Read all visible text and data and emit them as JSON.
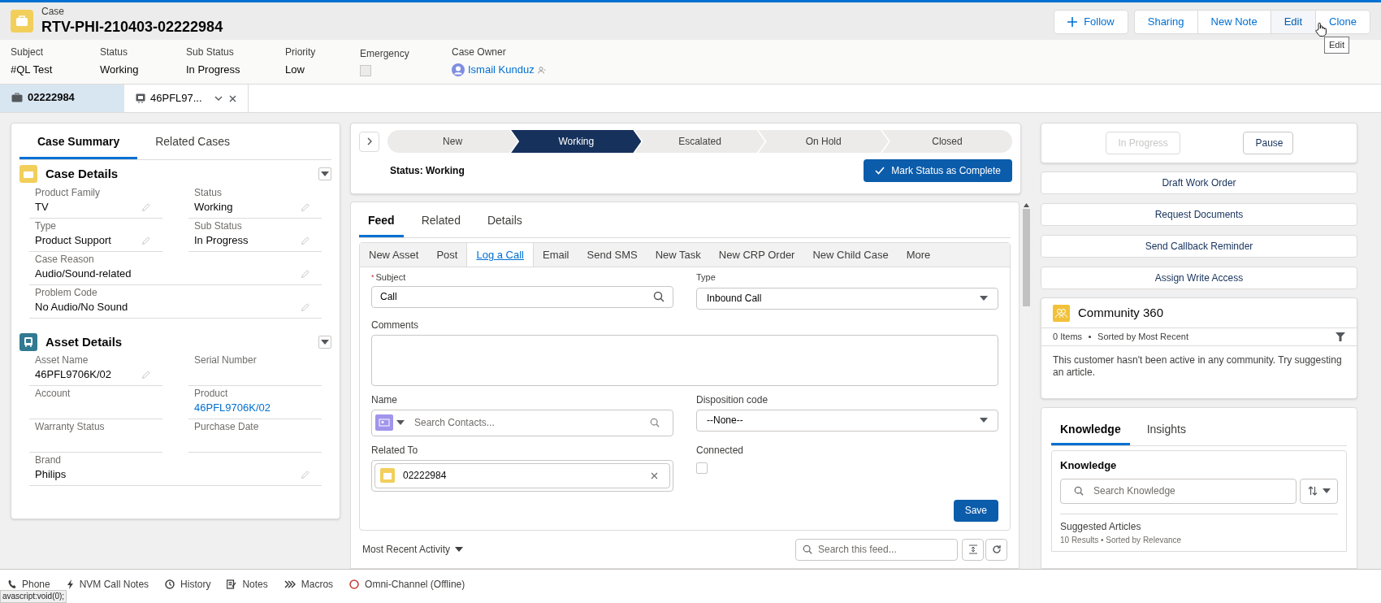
{
  "header": {
    "object_type": "Case",
    "title": "RTV-PHI-210403-02222984",
    "actions": [
      {
        "label": "Follow",
        "kind": "follow"
      },
      {
        "label": "Sharing",
        "kind": "plain"
      },
      {
        "label": "New Note",
        "kind": "plain"
      },
      {
        "label": "Edit",
        "kind": "hovered"
      },
      {
        "label": "Clone",
        "kind": "plain"
      }
    ],
    "tooltip": "Edit"
  },
  "highlights": [
    {
      "label": "Subject",
      "value": "#QL Test",
      "kind": "text"
    },
    {
      "label": "Status",
      "value": "Working",
      "kind": "text"
    },
    {
      "label": "Sub Status",
      "value": "In Progress",
      "kind": "text"
    },
    {
      "label": "Priority",
      "value": "Low",
      "kind": "text"
    },
    {
      "label": "Emergency",
      "kind": "checkbox",
      "checked": false
    },
    {
      "label": "Case Owner",
      "value": "Ismail Kunduz",
      "kind": "user"
    }
  ],
  "workspace_tabs": [
    {
      "label": "02222984",
      "selected": true,
      "kind": "case"
    },
    {
      "label": "46PFL97...",
      "selected": false,
      "kind": "asset"
    }
  ],
  "left": {
    "tabs": [
      {
        "label": "Case Summary",
        "selected": true
      },
      {
        "label": "Related Cases",
        "selected": false
      }
    ],
    "sections": [
      {
        "title": "Case Details",
        "kind": "case",
        "fields": [
          {
            "label": "Product Family",
            "value": "TV",
            "editable": true,
            "wide": false,
            "link": false
          },
          {
            "label": "Status",
            "value": "Working",
            "editable": true,
            "wide": false,
            "link": false
          },
          {
            "label": "Type",
            "value": "Product Support",
            "editable": true,
            "wide": false,
            "link": false
          },
          {
            "label": "Sub Status",
            "value": "In Progress",
            "editable": true,
            "wide": false,
            "link": false
          },
          {
            "label": "Case Reason",
            "value": "Audio/Sound-related",
            "editable": true,
            "wide": true,
            "link": false
          },
          {
            "label": "Problem Code",
            "value": "No Audio/No Sound",
            "editable": true,
            "wide": true,
            "link": false
          }
        ]
      },
      {
        "title": "Asset Details",
        "kind": "asset",
        "fields": [
          {
            "label": "Asset Name",
            "value": "46PFL9706K/02",
            "editable": true,
            "wide": false,
            "link": false
          },
          {
            "label": "Serial Number",
            "editable": false,
            "wide": false
          },
          {
            "label": "Account",
            "editable": false,
            "wide": false
          },
          {
            "label": "Product",
            "value": "46PFL9706K/02",
            "editable": false,
            "wide": false,
            "link": true
          },
          {
            "label": "Warranty Status",
            "editable": false,
            "wide": false
          },
          {
            "label": "Purchase Date",
            "editable": false,
            "wide": false
          },
          {
            "label": "Brand",
            "value": "Philips",
            "editable": true,
            "wide": true,
            "link": false
          }
        ]
      }
    ]
  },
  "path": {
    "stages": [
      {
        "label": "New",
        "selected": false
      },
      {
        "label": "Working",
        "selected": true
      },
      {
        "label": "Escalated",
        "selected": false
      },
      {
        "label": "On Hold",
        "selected": false
      },
      {
        "label": "Closed",
        "selected": false
      }
    ],
    "status_text": "Status: Working",
    "complete_button": "Mark Status as Complete"
  },
  "feed": {
    "tabs": [
      {
        "label": "Feed",
        "selected": true
      },
      {
        "label": "Related",
        "selected": false
      },
      {
        "label": "Details",
        "selected": false
      }
    ],
    "publisher_tabs": [
      {
        "label": "New Asset",
        "selected": false
      },
      {
        "label": "Post",
        "selected": false
      },
      {
        "label": "Log a Call",
        "selected": true
      },
      {
        "label": "Email",
        "selected": false
      },
      {
        "label": "Send SMS",
        "selected": false
      },
      {
        "label": "New Task",
        "selected": false
      },
      {
        "label": "New CRP Order",
        "selected": false
      },
      {
        "label": "New Child Case",
        "selected": false
      },
      {
        "label": "More",
        "selected": false
      }
    ],
    "form": {
      "required_mark": "*",
      "subject_label": "Subject",
      "subject_value": "Call",
      "type_label": "Type",
      "type_value": "Inbound Call",
      "comments_label": "Comments",
      "name_label": "Name",
      "name_placeholder": "Search Contacts...",
      "disposition_label": "Disposition code",
      "disposition_value": "--None--",
      "related_label": "Related To",
      "related_value": "02222984",
      "connected_label": "Connected",
      "connected_checked": false,
      "save": "Save"
    },
    "activity_filter": "Most Recent Activity",
    "search_placeholder": "Search this feed..."
  },
  "right": {
    "status_buttons": [
      {
        "label": "In Progress",
        "disabled": true
      },
      {
        "label": "Pause",
        "disabled": false
      }
    ],
    "actions": [
      "Draft Work Order",
      "Request Documents",
      "Send Callback Reminder",
      "Assign Write Access"
    ],
    "community": {
      "title": "Community 360",
      "count": "0 Items",
      "sort": "Sorted by Most Recent",
      "message": "This customer hasn't been active in any community. Try suggesting an article."
    },
    "knowledge": {
      "tabs": [
        {
          "label": "Knowledge",
          "selected": true
        },
        {
          "label": "Insights",
          "selected": false
        }
      ],
      "title": "Knowledge",
      "search_placeholder": "Search Knowledge",
      "suggested": "Suggested Articles",
      "results": "10 Results • Sorted by Relevance"
    }
  },
  "utility_bar": [
    {
      "label": "Phone",
      "kind": "phone"
    },
    {
      "label": "NVM Call Notes",
      "kind": "bolt"
    },
    {
      "label": "History",
      "kind": "clock"
    },
    {
      "label": "Notes",
      "kind": "note"
    },
    {
      "label": "Macros",
      "kind": "macros"
    },
    {
      "label": "Omni-Channel (Offline)",
      "kind": "omni"
    }
  ],
  "status_url": "avascript:void(0);"
}
